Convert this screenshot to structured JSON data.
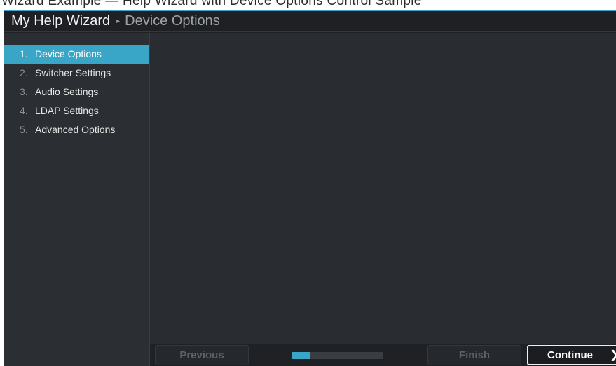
{
  "top_strip": {
    "text": "Wizard Example — Help Wizard with Device Options Control Sample"
  },
  "header": {
    "wizard_title": "My Help Wizard",
    "separator_icon": "chevron-right-icon",
    "current_step": "Device Options"
  },
  "sidebar": {
    "items": [
      {
        "number": "1.",
        "label": "Device Options",
        "active": true
      },
      {
        "number": "2.",
        "label": "Switcher Settings",
        "active": false
      },
      {
        "number": "3.",
        "label": "Audio Settings",
        "active": false
      },
      {
        "number": "4.",
        "label": "LDAP Settings",
        "active": false
      },
      {
        "number": "5.",
        "label": "Advanced Options",
        "active": false
      }
    ]
  },
  "footer": {
    "previous_label": "Previous",
    "finish_label": "Finish",
    "continue_label": "Continue",
    "continue_icon": "chevron-right-icon",
    "progress_fraction": 0.2
  },
  "colors": {
    "accent": "#3aa6c7",
    "sidebar_bg": "#2b2e33",
    "content_bg": "#292c31",
    "header_bg": "#1e2024"
  }
}
